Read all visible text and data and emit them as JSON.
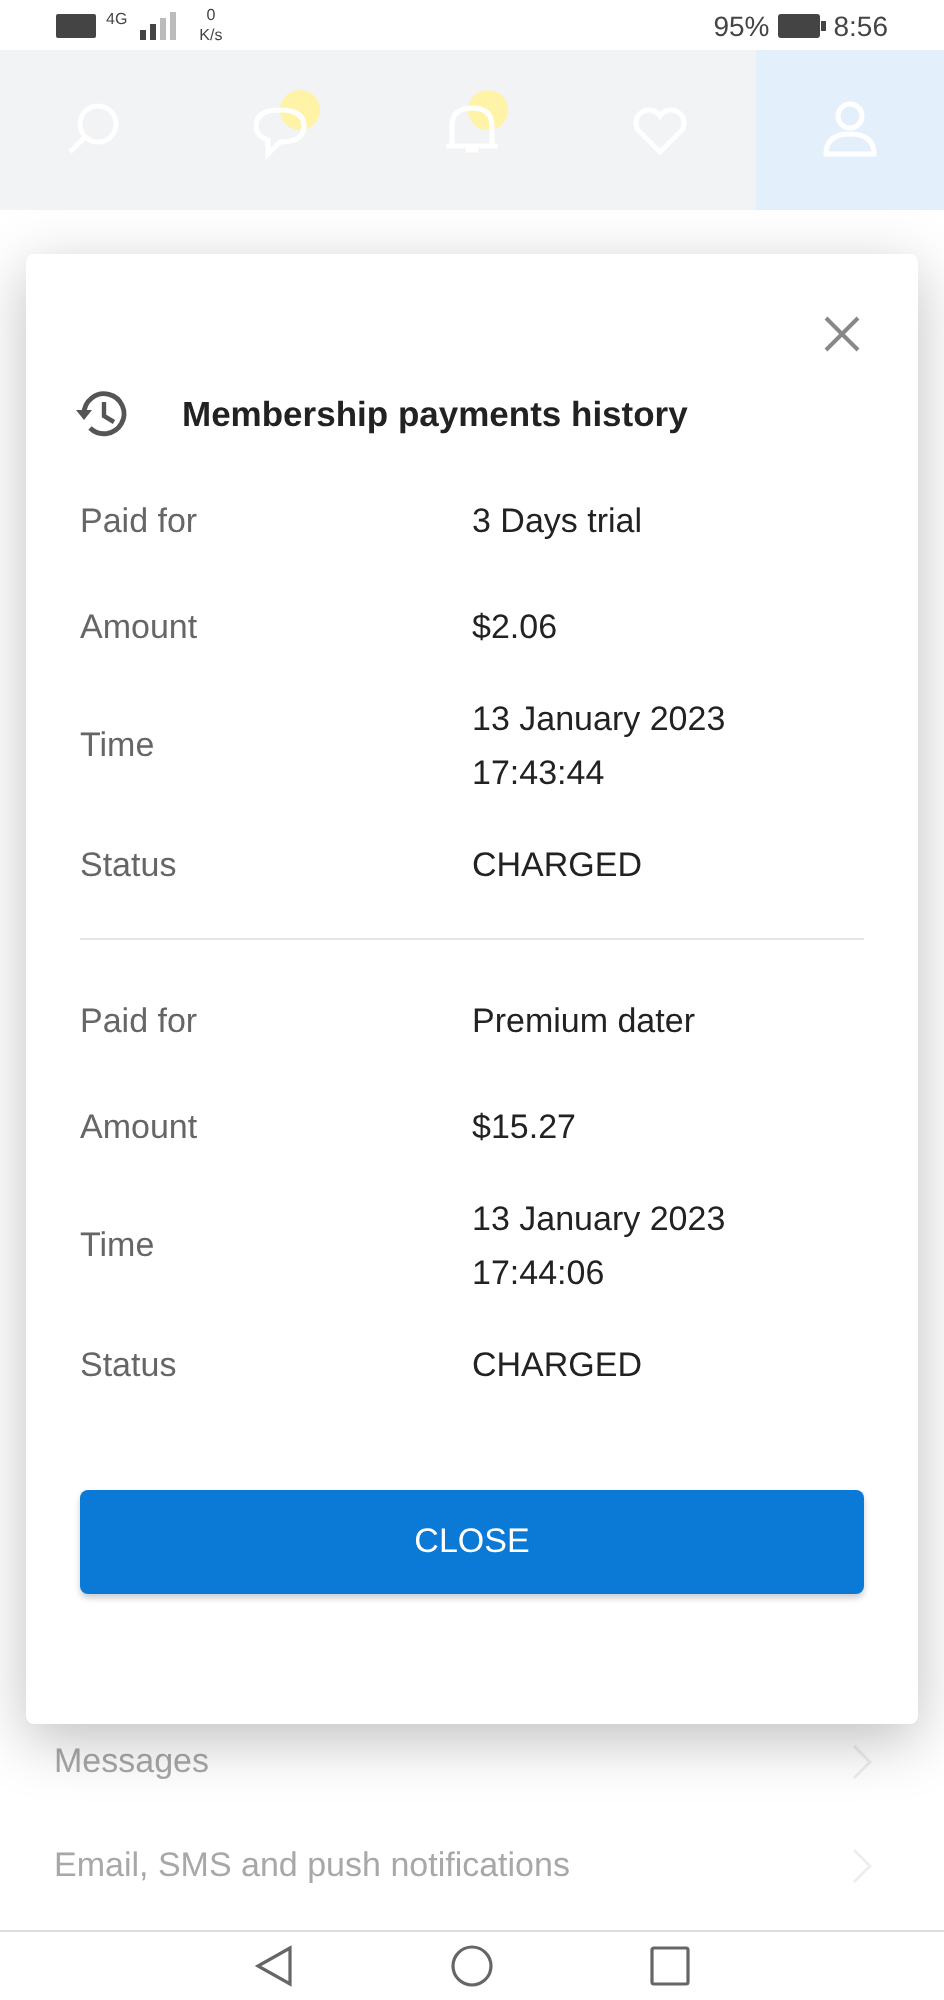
{
  "status_bar": {
    "network": "4G",
    "speed_value": "0",
    "speed_unit": "K/s",
    "battery": "95%",
    "time": "8:56"
  },
  "nav_tabs": [
    {
      "badge": false,
      "selected": false
    },
    {
      "badge": true,
      "selected": false
    },
    {
      "badge": true,
      "selected": false
    },
    {
      "badge": false,
      "selected": false
    },
    {
      "badge": false,
      "selected": true
    }
  ],
  "background_items": [
    {
      "label": "Messages"
    },
    {
      "label": "Email, SMS and push notifications"
    }
  ],
  "dialog": {
    "title": "Membership payments history",
    "payments": [
      {
        "rows": [
          {
            "label": "Paid for",
            "value": "3 Days trial"
          },
          {
            "label": "Amount",
            "value": "$2.06"
          },
          {
            "label": "Time",
            "value": "13 January 2023 17:43:44"
          },
          {
            "label": "Status",
            "value": "CHARGED"
          }
        ]
      },
      {
        "rows": [
          {
            "label": "Paid for",
            "value": "Premium dater"
          },
          {
            "label": "Amount",
            "value": "$15.27"
          },
          {
            "label": "Time",
            "value": "13 January 2023 17:44:06"
          },
          {
            "label": "Status",
            "value": "CHARGED"
          }
        ]
      }
    ],
    "button": "CLOSE"
  }
}
